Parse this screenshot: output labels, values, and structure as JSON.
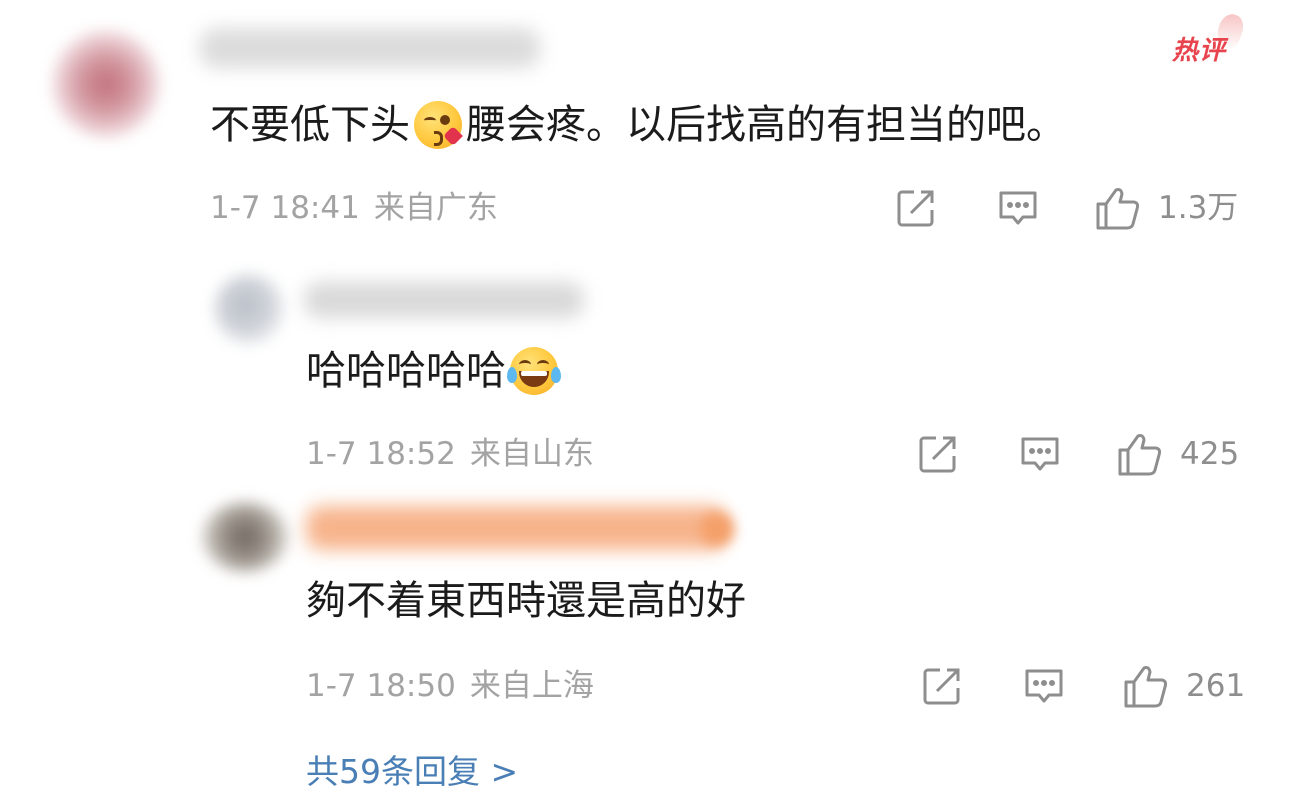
{
  "hot_badge": "热评",
  "main_comment": {
    "text_before_emoji": "不要低下头",
    "emoji": "kissing-heart-emoji",
    "text_after_emoji": "腰会疼。以后找高的有担当的吧。",
    "date": "1-7 18:41",
    "location": "来自广东",
    "likes": "1.3万"
  },
  "replies": [
    {
      "text": "哈哈哈哈哈",
      "emoji": "laughing-tears-emoji",
      "date": "1-7 18:52",
      "location": "来自山东",
      "likes": "425"
    },
    {
      "text": "夠不着東西時還是高的好",
      "date": "1-7 18:50",
      "location": "来自上海",
      "likes": "261"
    }
  ],
  "more_replies": "共59条回复 >",
  "colors": {
    "hot": "#e8444d",
    "meta": "#a3a3a3",
    "link": "#4a7fb5",
    "icon": "#8e8e8e"
  }
}
